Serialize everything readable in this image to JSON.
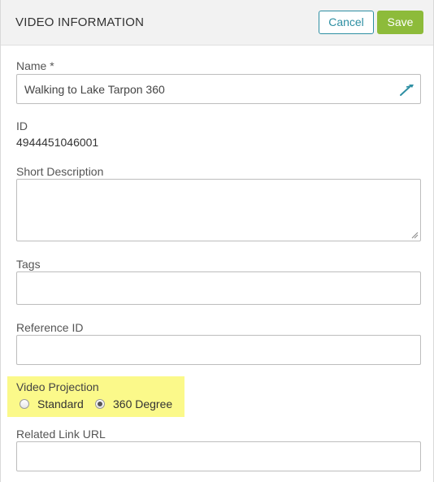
{
  "header": {
    "title": "VIDEO INFORMATION",
    "cancel_label": "Cancel",
    "save_label": "Save"
  },
  "fields": {
    "name": {
      "label": "Name *",
      "value": "Walking to Lake Tarpon 360",
      "icon": "edit-pen-icon"
    },
    "id": {
      "label": "ID",
      "value": "4944451046001"
    },
    "short_description": {
      "label": "Short Description",
      "value": ""
    },
    "tags": {
      "label": "Tags",
      "value": ""
    },
    "reference_id": {
      "label": "Reference ID",
      "value": ""
    },
    "video_projection": {
      "label": "Video Projection",
      "options": [
        {
          "label": "Standard",
          "selected": false
        },
        {
          "label": "360 Degree",
          "selected": true
        }
      ]
    },
    "related_link_url": {
      "label": "Related Link URL",
      "value": ""
    }
  },
  "colors": {
    "accent": "#2e8fa3",
    "save_button": "#8dbb3a",
    "highlight": "#fbf98a"
  }
}
